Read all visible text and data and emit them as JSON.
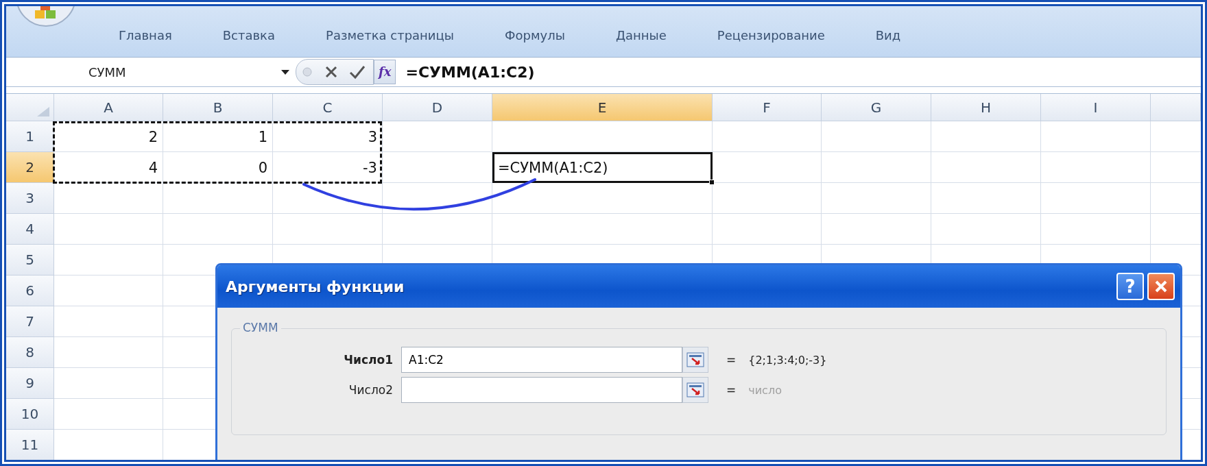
{
  "ribbon": {
    "tabs": [
      {
        "label": "Главная",
        "selected": false
      },
      {
        "label": "Вставка",
        "selected": false
      },
      {
        "label": "Разметка страницы",
        "selected": false
      },
      {
        "label": "Формулы",
        "selected": false
      },
      {
        "label": "Данные",
        "selected": false
      },
      {
        "label": "Рецензирование",
        "selected": false
      },
      {
        "label": "Вид",
        "selected": false
      }
    ]
  },
  "formula_bar": {
    "name_box": "СУММ",
    "function_button": "fx",
    "formula": "=СУММ(A1:C2)"
  },
  "sheet": {
    "columns": [
      {
        "label": "A",
        "selected": false
      },
      {
        "label": "B",
        "selected": false
      },
      {
        "label": "C",
        "selected": false
      },
      {
        "label": "D",
        "selected": false
      },
      {
        "label": "E",
        "selected": true
      },
      {
        "label": "F",
        "selected": false
      },
      {
        "label": "G",
        "selected": false
      },
      {
        "label": "H",
        "selected": false
      },
      {
        "label": "I",
        "selected": false
      }
    ],
    "rows": [
      {
        "label": "1",
        "selected": false,
        "cells": [
          {
            "kind": "number",
            "text": "2",
            "marked": true
          },
          {
            "kind": "number",
            "text": "1",
            "marked": true
          },
          {
            "kind": "number",
            "text": "3",
            "marked": true
          }
        ]
      },
      {
        "label": "2",
        "selected": true,
        "cells": [
          {
            "kind": "number",
            "text": "4",
            "marked": true
          },
          {
            "kind": "number",
            "text": "0",
            "marked": true
          },
          {
            "kind": "number",
            "text": "-3",
            "marked": true
          },
          null,
          {
            "kind": "active",
            "text": "=СУММ(A1:C2)",
            "marked": false
          }
        ]
      },
      {
        "label": "3",
        "selected": false
      },
      {
        "label": "4",
        "selected": false
      },
      {
        "label": "5",
        "selected": false
      },
      {
        "label": "6",
        "selected": false
      },
      {
        "label": "7",
        "selected": false
      },
      {
        "label": "8",
        "selected": false
      },
      {
        "label": "9",
        "selected": false
      },
      {
        "label": "10",
        "selected": false
      },
      {
        "label": "11",
        "selected": false
      }
    ]
  },
  "dialog": {
    "title": "Аргументы функции",
    "help": "?",
    "group_label": "СУММ",
    "arguments": [
      {
        "label": "Число1",
        "required": true,
        "value": "A1:C2",
        "equals": "=",
        "result": "{2;1;3:4;0;-3}",
        "hint": false
      },
      {
        "label": "Число2",
        "required": false,
        "equals": "=",
        "result": "число",
        "hint": true
      }
    ]
  }
}
